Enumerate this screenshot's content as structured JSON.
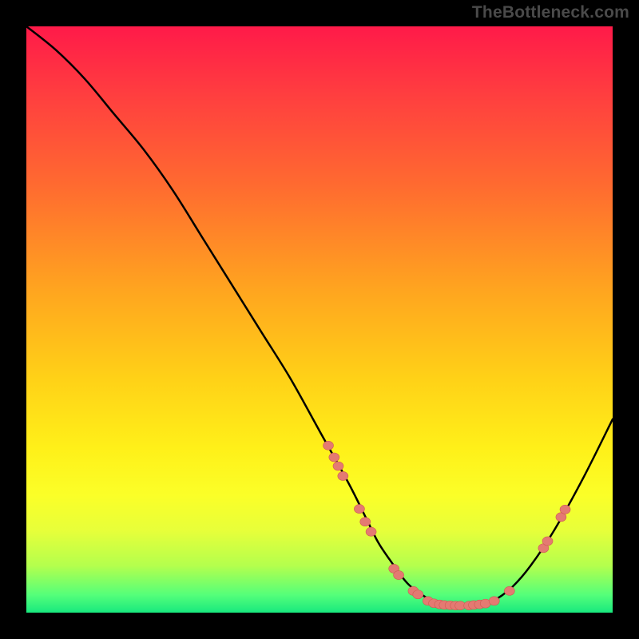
{
  "watermark": "TheBottleneck.com",
  "chart_data": {
    "type": "line",
    "title": "",
    "xlabel": "",
    "ylabel": "",
    "xlim": [
      0,
      100
    ],
    "ylim": [
      0,
      100
    ],
    "series": [
      {
        "name": "curve",
        "x": [
          0,
          5,
          10,
          15,
          20,
          25,
          30,
          35,
          40,
          45,
          50,
          55,
          58,
          60,
          62,
          65,
          68,
          70,
          72,
          75,
          78,
          80,
          83,
          86,
          90,
          95,
          100
        ],
        "y": [
          100,
          96,
          91,
          85,
          79,
          72,
          64,
          56,
          48,
          40,
          31,
          22,
          16,
          12,
          9,
          5,
          2.7,
          1.8,
          1.3,
          1.2,
          1.5,
          2.2,
          4.5,
          8,
          14,
          23,
          33
        ]
      }
    ],
    "markers": [
      {
        "x": 51.5,
        "y": 28.5
      },
      {
        "x": 52.5,
        "y": 26.5
      },
      {
        "x": 53.2,
        "y": 25.0
      },
      {
        "x": 54.0,
        "y": 23.3
      },
      {
        "x": 56.8,
        "y": 17.7
      },
      {
        "x": 57.8,
        "y": 15.5
      },
      {
        "x": 58.8,
        "y": 13.8
      },
      {
        "x": 62.7,
        "y": 7.5
      },
      {
        "x": 63.5,
        "y": 6.4
      },
      {
        "x": 66.0,
        "y": 3.7
      },
      {
        "x": 66.8,
        "y": 3.1
      },
      {
        "x": 68.5,
        "y": 2.0
      },
      {
        "x": 69.5,
        "y": 1.6
      },
      {
        "x": 70.5,
        "y": 1.4
      },
      {
        "x": 71.3,
        "y": 1.3
      },
      {
        "x": 72.3,
        "y": 1.25
      },
      {
        "x": 73.2,
        "y": 1.2
      },
      {
        "x": 74.0,
        "y": 1.2
      },
      {
        "x": 75.5,
        "y": 1.2
      },
      {
        "x": 76.3,
        "y": 1.3
      },
      {
        "x": 77.3,
        "y": 1.4
      },
      {
        "x": 78.3,
        "y": 1.55
      },
      {
        "x": 79.8,
        "y": 2.0
      },
      {
        "x": 82.4,
        "y": 3.7
      },
      {
        "x": 88.2,
        "y": 11.0
      },
      {
        "x": 88.9,
        "y": 12.2
      },
      {
        "x": 91.2,
        "y": 16.3
      },
      {
        "x": 91.9,
        "y": 17.6
      }
    ],
    "colors": {
      "curve_stroke": "#000000",
      "marker_fill": "#e47a72",
      "marker_stroke": "#cf5a52"
    }
  }
}
